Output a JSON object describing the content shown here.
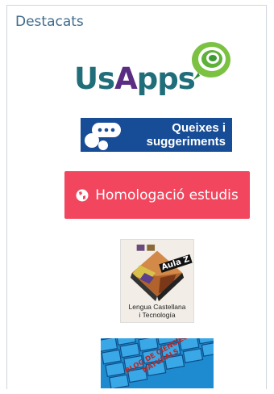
{
  "panel": {
    "title": "Destacats"
  },
  "usapps": {
    "logo_text_parts": [
      "Us",
      "A",
      "pps"
    ],
    "colors": {
      "us": "#1f6e7a",
      "a": "#5a2d82",
      "pps": "#1f6e7a",
      "swirl": "#7bc142"
    }
  },
  "queixes": {
    "line1": "Queixes i",
    "line2": "suggeriments",
    "background": "#174d97"
  },
  "homologacio": {
    "label": "Homologació estudis",
    "icon": "globe-icon",
    "background": "#f2465e"
  },
  "aula_z": {
    "badge_text": "Aula Z",
    "caption_line1": "Lengua Castellana",
    "caption_line2": "i Tecnología"
  },
  "ciencies": {
    "banner_line1": "BLOG DE CIÈNCIES",
    "banner_line2": "NATURALS"
  }
}
